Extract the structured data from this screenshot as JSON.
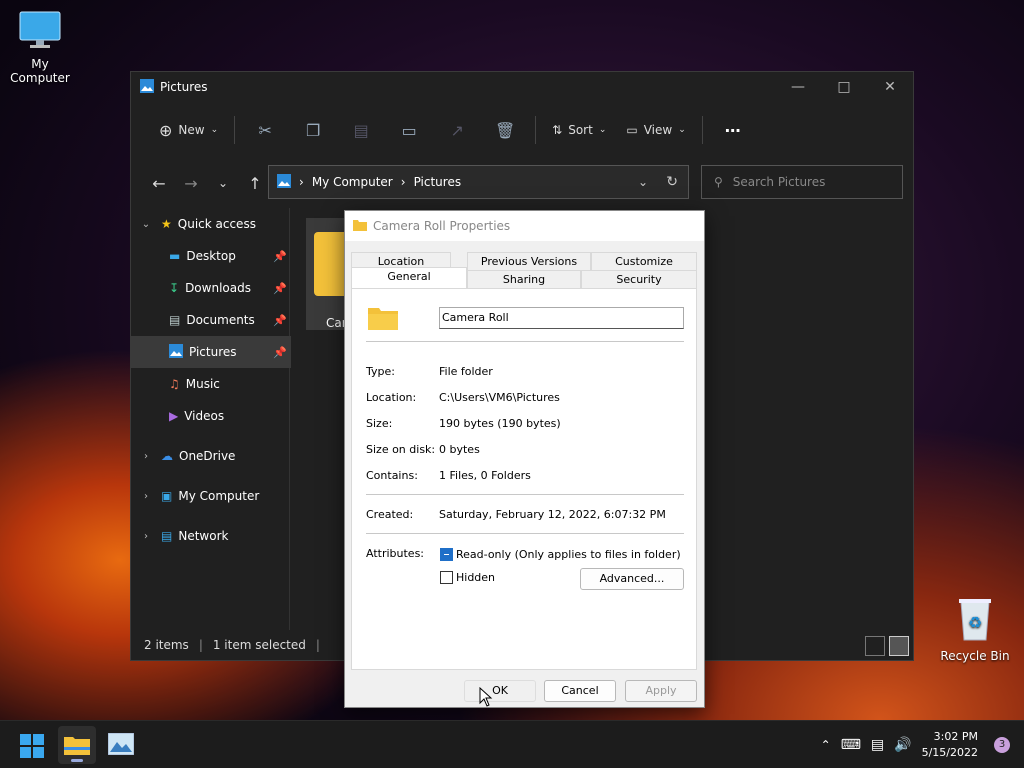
{
  "desktop": {
    "my_computer_label": "My Computer",
    "recycle_bin_label": "Recycle Bin"
  },
  "explorer": {
    "title": "Pictures",
    "toolbar": {
      "new_label": "New",
      "sort_label": "Sort",
      "view_label": "View"
    },
    "address": {
      "crumbs": [
        "My Computer",
        "Pictures"
      ]
    },
    "search_placeholder": "Search Pictures",
    "sidebar": {
      "quick_access": "Quick access",
      "items": [
        {
          "label": "Desktop"
        },
        {
          "label": "Downloads"
        },
        {
          "label": "Documents"
        },
        {
          "label": "Pictures"
        },
        {
          "label": "Music"
        },
        {
          "label": "Videos"
        }
      ],
      "onedrive": "OneDrive",
      "my_computer": "My Computer",
      "network": "Network"
    },
    "content": {
      "folder_label_partial": "Car"
    },
    "status": {
      "items": "2 items",
      "selected": "1 item selected"
    }
  },
  "dialog": {
    "title": "Camera Roll Properties",
    "tabs_top": [
      "Location",
      "Previous Versions",
      "Customize"
    ],
    "tabs_bottom": [
      "General",
      "Sharing",
      "Security"
    ],
    "name": "Camera Roll",
    "type_label": "Type:",
    "type_value": "File folder",
    "location_label": "Location:",
    "location_value": "C:\\Users\\VM6\\Pictures",
    "size_label": "Size:",
    "size_value": "190 bytes (190 bytes)",
    "size_on_disk_label": "Size on disk:",
    "size_on_disk_value": "0 bytes",
    "contains_label": "Contains:",
    "contains_value": "1 Files, 0 Folders",
    "created_label": "Created:",
    "created_value": "Saturday, February 12, 2022, 6:07:32 PM",
    "attributes_label": "Attributes:",
    "readonly_label": "Read-only (Only applies to files in folder)",
    "hidden_label": "Hidden",
    "advanced_label": "Advanced...",
    "ok_label": "OK",
    "cancel_label": "Cancel",
    "apply_label": "Apply"
  },
  "taskbar": {
    "time": "3:02 PM",
    "date": "5/15/2022",
    "notification_count": "3"
  }
}
